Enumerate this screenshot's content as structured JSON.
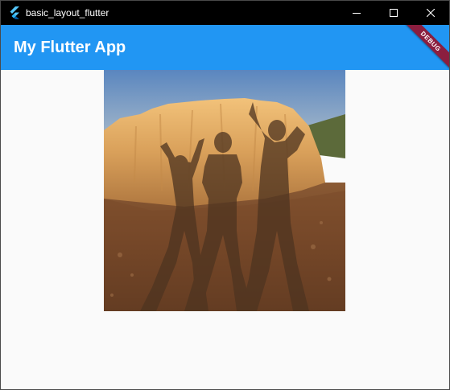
{
  "window": {
    "title": "basic_layout_flutter",
    "icon": "flutter-logo-icon",
    "controls": [
      "minimize-icon",
      "maximize-icon",
      "close-icon"
    ]
  },
  "appbar": {
    "title": "My Flutter App",
    "color": "#2196f3"
  },
  "debug_banner": {
    "label": "DEBUG",
    "color": "#8b1e3f"
  },
  "content": {
    "image": {
      "description_icon": "photo-shadows-on-rock"
    }
  }
}
